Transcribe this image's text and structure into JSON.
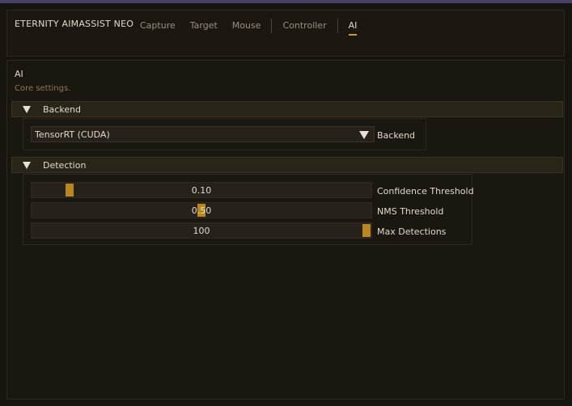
{
  "app": {
    "title": "ETERNITY AIMASSIST NEO"
  },
  "nav": {
    "items": [
      {
        "label": "Capture"
      },
      {
        "label": "Target"
      },
      {
        "label": "Mouse"
      },
      {
        "label": "Controller"
      },
      {
        "label": "AI"
      }
    ],
    "active": "AI"
  },
  "section": {
    "title": "AI",
    "subtitle": "Core settings."
  },
  "backend_group": {
    "label": "Backend",
    "backend": {
      "value": "TensorRT (CUDA)",
      "label": "Backend"
    }
  },
  "detection_group": {
    "label": "Detection",
    "confidence": {
      "value": "0.10",
      "fraction": 0.1,
      "label": "Confidence Threshold"
    },
    "nms": {
      "value": "0.50",
      "fraction": 0.5,
      "label": "NMS Threshold"
    },
    "max_detections": {
      "value": "100",
      "fraction": 1.0,
      "label": "Max Detections"
    }
  },
  "colors": {
    "accent": "#c79a2a",
    "background": "#17140f",
    "frame": "#2a2519"
  }
}
